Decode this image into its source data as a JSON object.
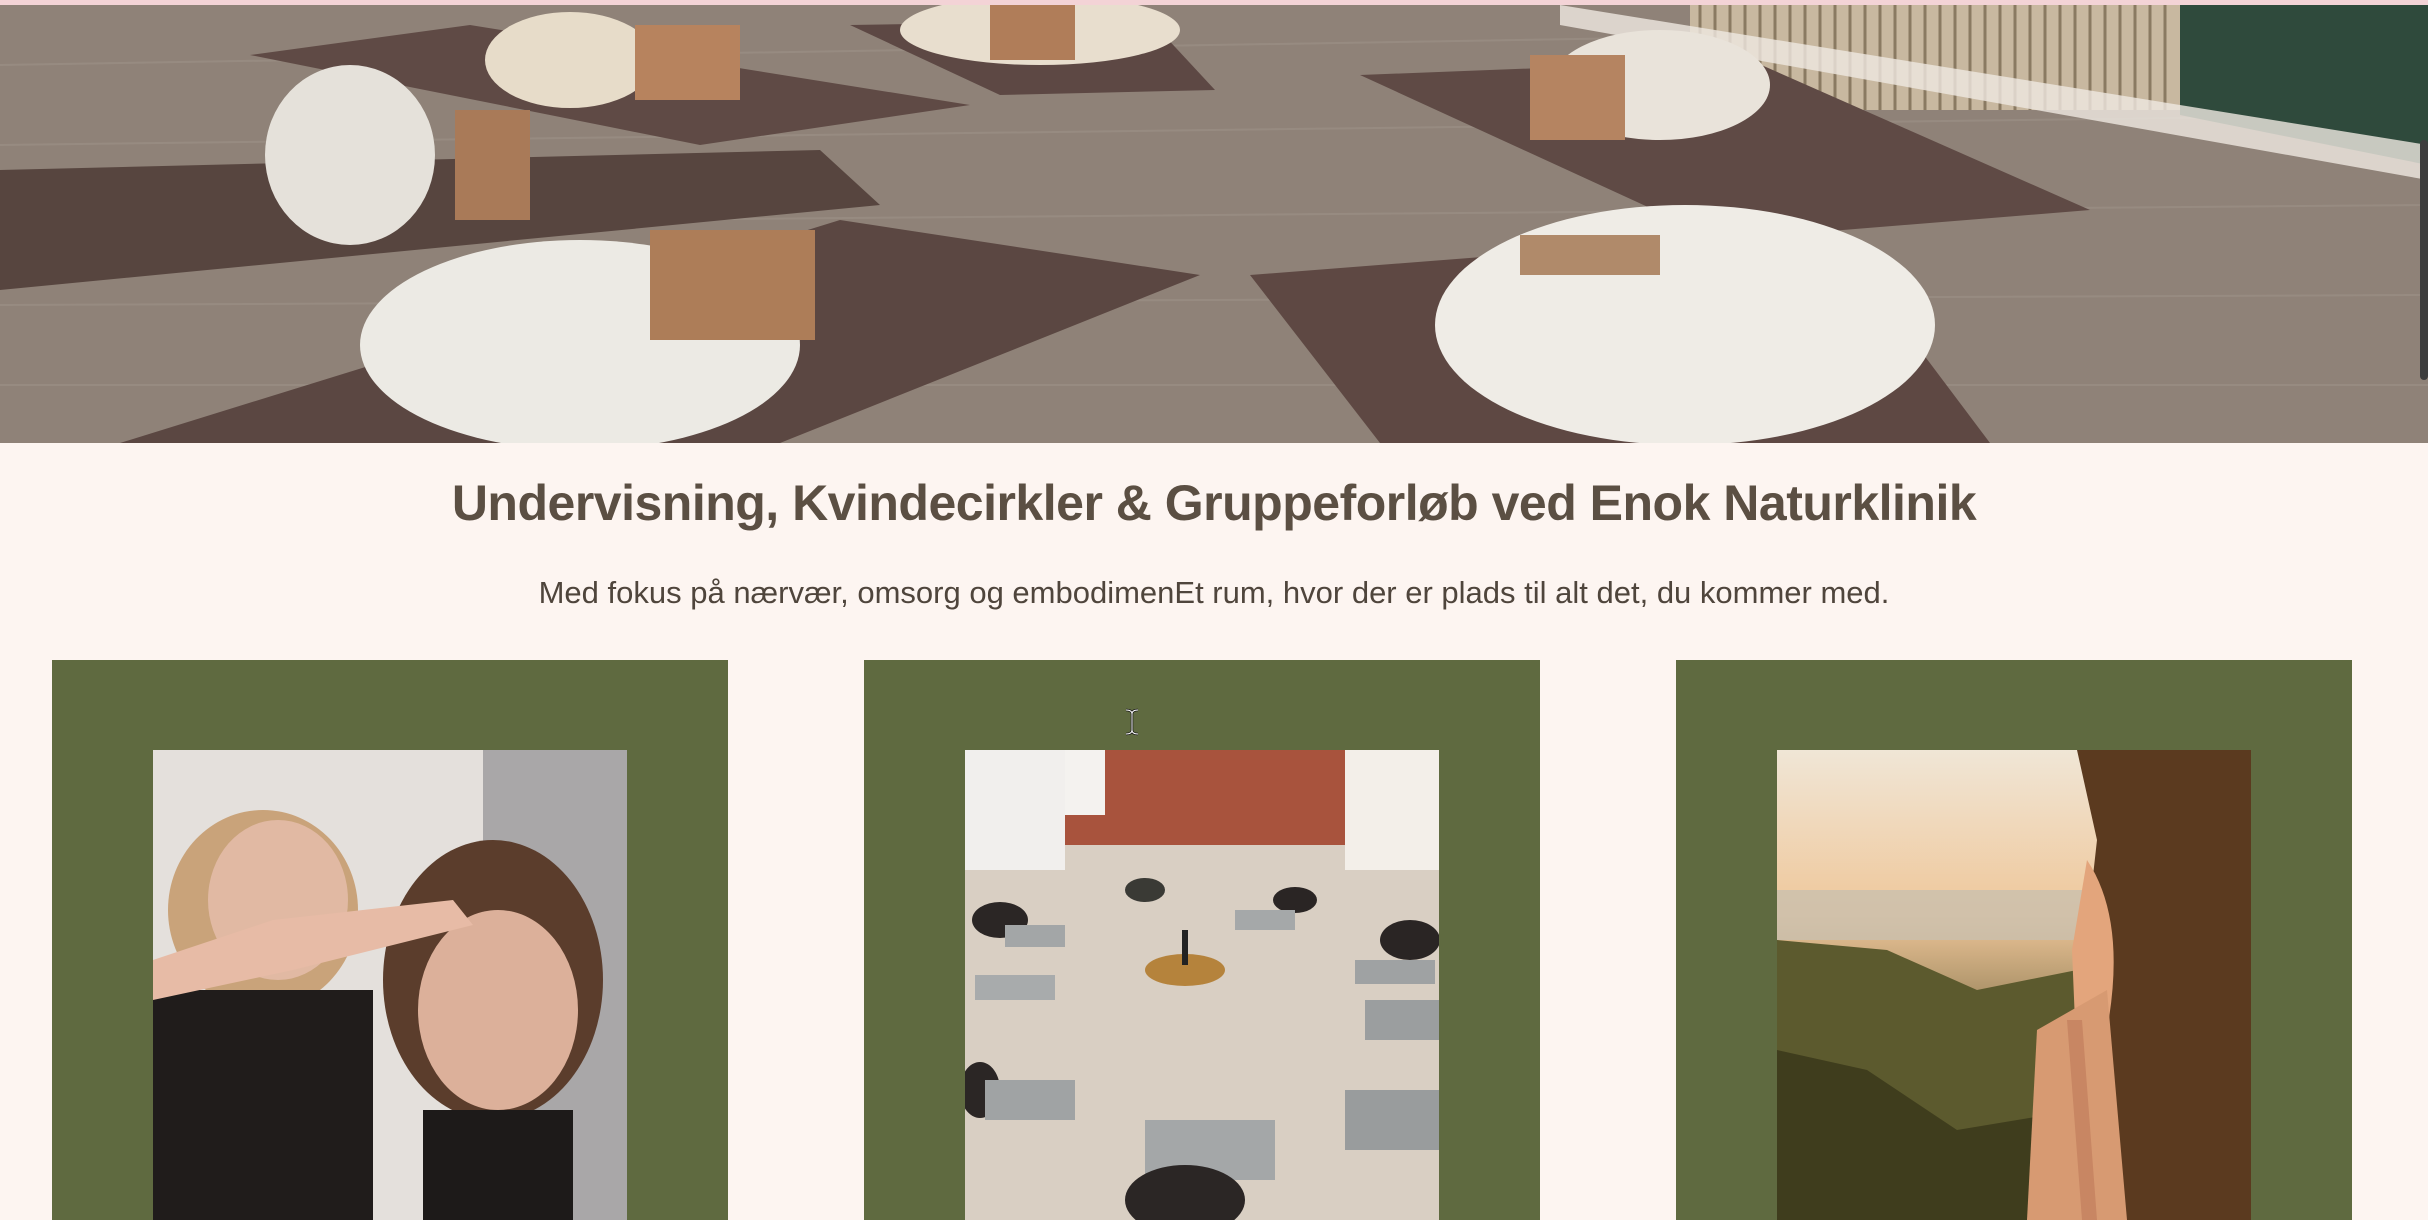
{
  "page": {
    "title": "Undervisning, Kvindecirkler & Gruppeforløb ved Enok Naturklinik",
    "subtitle": "Med fokus på nærvær, omsorg og embodimenEt rum, hvor der er plads til alt det, du kommer med."
  },
  "colors": {
    "background": "#fdf5f1",
    "card": "#5f6a40",
    "title": "#5b4f43",
    "text": "#4f453c"
  },
  "cards": [
    {
      "image": "woman-receiving-head-massage-photo"
    },
    {
      "image": "women-circle-room-photo"
    },
    {
      "image": "woman-praying-sunset-photo"
    }
  ],
  "icons": {
    "cursor": "text-cursor-icon"
  }
}
